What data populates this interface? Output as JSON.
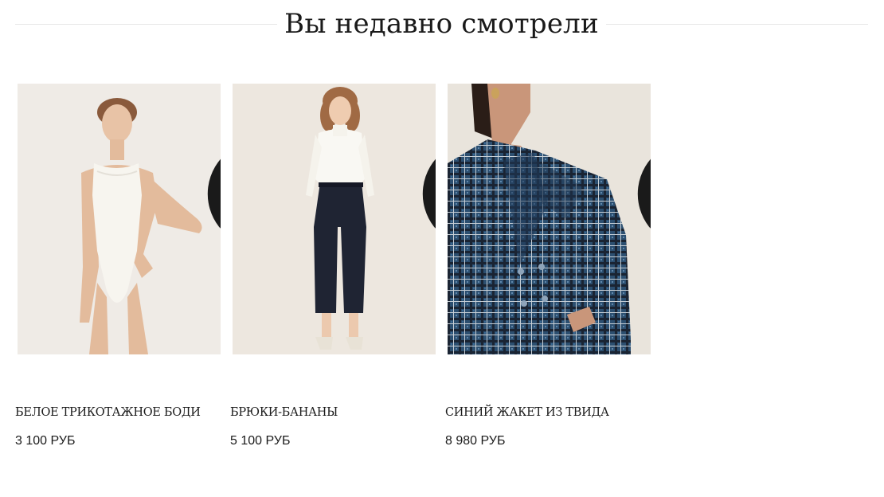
{
  "section": {
    "title": "Вы недавно смотрели"
  },
  "products": [
    {
      "name": "Белое трикотажное боди",
      "price": "3 100 РУБ",
      "image_icon": "photo-model-white-bodysuit"
    },
    {
      "name": "Брюки-бананы",
      "price": "5 100 РУБ",
      "image_icon": "photo-model-navy-trousers"
    },
    {
      "name": "Синий жакет из твида",
      "price": "8 980 РУБ",
      "image_icon": "photo-model-blue-tweed-jacket"
    }
  ],
  "colors": {
    "text": "#1a1a1a",
    "divider": "#e6e6e6",
    "photo_background": "#ede6dc"
  },
  "icons": {
    "favorite": "heart-outline-icon"
  }
}
